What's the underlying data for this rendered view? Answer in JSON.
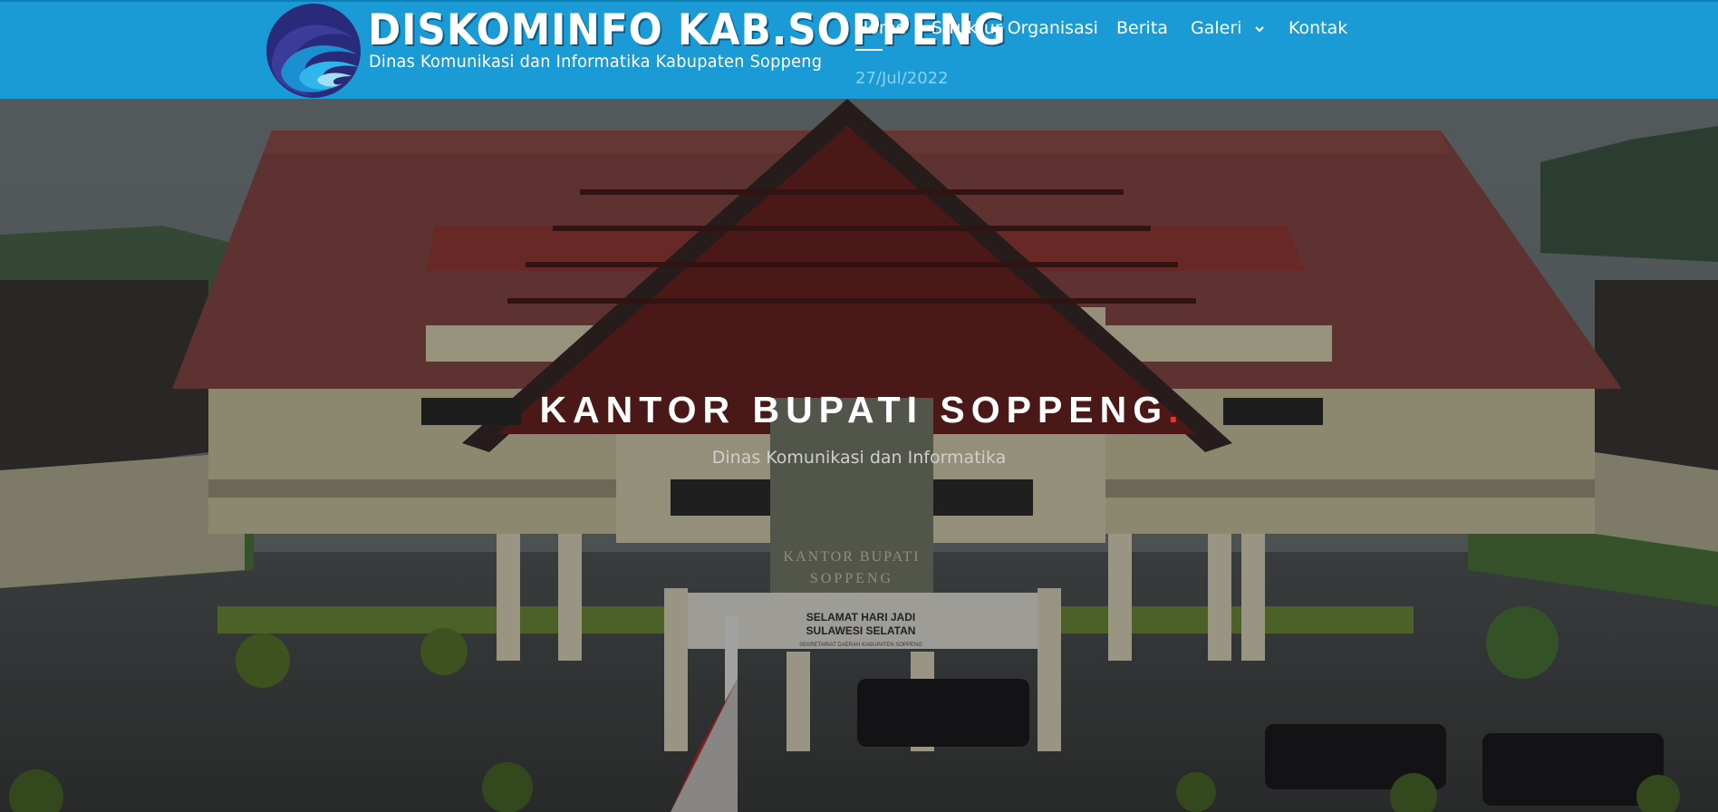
{
  "header": {
    "brand_title": "DISKOMINFO KAB.SOPPENG",
    "brand_subtitle": "Dinas Komunikasi dan Informatika Kabupaten Soppeng",
    "logo_icon": "wave-logo-icon",
    "date": "27/Jul/2022",
    "colors": {
      "bar": "#1a9bd6",
      "date": "#8fd0ee"
    }
  },
  "nav": {
    "items": [
      {
        "label": "Home",
        "active": true
      },
      {
        "label": "Struktur Organisasi"
      },
      {
        "label": "Berita"
      },
      {
        "label": "Galeri",
        "icon": "chevron-down-icon"
      },
      {
        "label": "Kontak"
      }
    ]
  },
  "hero": {
    "title": "KANTOR BUPATI SOPPENG",
    "title_dot": ".",
    "subtitle": "Dinas Komunikasi dan Informatika",
    "accent_color": "#e8322b",
    "building": {
      "banner_line1": "SELAMAT HARI JADI",
      "banner_line2": "SULAWESI SELATAN",
      "banner_footer": "SEKRETARIAT DAERAH KABUPATEN SOPPENG",
      "plaque_line1": "KANTOR BUPATI",
      "plaque_line2": "SOPPENG"
    }
  }
}
